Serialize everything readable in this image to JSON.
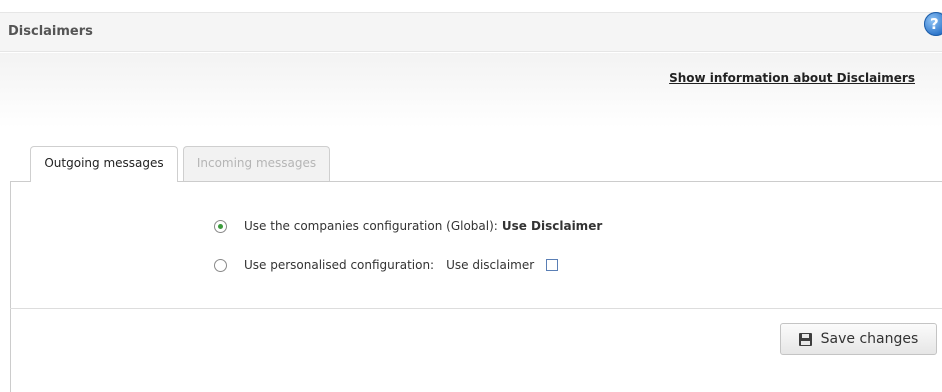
{
  "page": {
    "title": "Disclaimers",
    "info_link": "Show information about Disclaimers",
    "help_icon": "?"
  },
  "tabs": [
    {
      "label": "Outgoing messages",
      "active": true
    },
    {
      "label": "Incoming messages",
      "active": false
    }
  ],
  "options": {
    "global": {
      "label": "Use the companies configuration (Global):",
      "value": "Use Disclaimer",
      "selected": true
    },
    "personal": {
      "label": "Use personalised configuration:",
      "checkbox_label": "Use disclaimer",
      "selected": false,
      "checked": false
    }
  },
  "actions": {
    "save_label": "Save changes",
    "save_icon": "floppy-disk-icon"
  },
  "colors": {
    "radio_selected": "#3c9a3c",
    "help_icon": "#2a73c9"
  }
}
